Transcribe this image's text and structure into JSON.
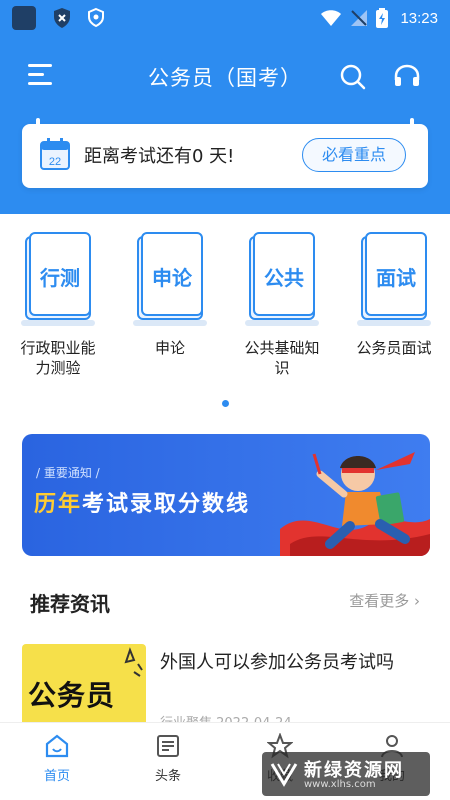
{
  "status_bar": {
    "time": "13:23"
  },
  "header": {
    "title": "公务员（国考）"
  },
  "countdown": {
    "text": "距离考试还有0 天!",
    "calendar_day": "22",
    "button_label": "必看重点"
  },
  "categories": [
    {
      "icon_label": "行测",
      "name_line1": "行政职业能",
      "name_line2": "力测验"
    },
    {
      "icon_label": "申论",
      "name_line1": "申论",
      "name_line2": ""
    },
    {
      "icon_label": "公共",
      "name_line1": "公共基础知",
      "name_line2": "识"
    },
    {
      "icon_label": "面试",
      "name_line1": "公务员面试",
      "name_line2": ""
    }
  ],
  "banner": {
    "notice": "/ 重要通知 /",
    "title_highlight": "历年",
    "title_rest": "考试录取分数线"
  },
  "news": {
    "section_title": "推荐资讯",
    "more_label": "查看更多",
    "items": [
      {
        "thumb_text": "公务员",
        "title": "外国人可以参加公务员考试吗",
        "meta": "行业聚焦 2022-04-24"
      }
    ]
  },
  "tabs": [
    {
      "label": "首页",
      "icon": "home-icon",
      "active": true
    },
    {
      "label": "头条",
      "icon": "news-icon",
      "active": false
    },
    {
      "label": "收藏",
      "icon": "star-icon",
      "active": false
    },
    {
      "label": "我的",
      "icon": "profile-icon",
      "active": false
    }
  ],
  "watermark": {
    "line1": "新绿资源网",
    "line2": "www.xlhs.com"
  },
  "colors": {
    "primary": "#2d8cf0",
    "banner_highlight": "#ffcc33",
    "thumb_bg": "#f6e04a"
  }
}
